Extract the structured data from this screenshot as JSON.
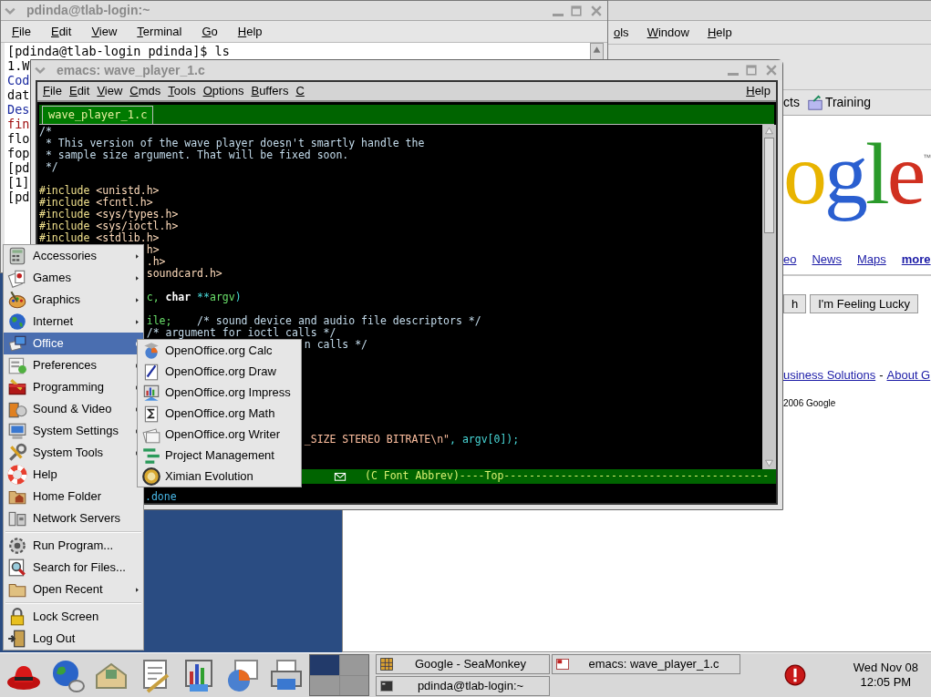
{
  "browser": {
    "menu": [
      "ols",
      "Window",
      "Help"
    ],
    "bookmarks": [
      {
        "text": "cts",
        "kind": "link"
      },
      {
        "text": "Training",
        "kind": "folder"
      }
    ],
    "logo": "ogle",
    "logo_mark": "™",
    "nav_links": [
      {
        "text": "eo",
        "emphasis": false
      },
      {
        "text": "News",
        "emphasis": false
      },
      {
        "text": "Maps",
        "emphasis": false
      },
      {
        "text": "more",
        "emphasis": true
      }
    ],
    "buttons": [
      "h",
      "I'm Feeling Lucky"
    ],
    "footer": [
      {
        "text": "usiness Solutions",
        "kind": "link"
      },
      {
        "text": "-",
        "kind": "text"
      },
      {
        "text": "About G",
        "kind": "link"
      }
    ],
    "copyright": "2006 Google"
  },
  "terminal": {
    "title": "pdinda@tlab-login:~",
    "menu": [
      "File",
      "Edit",
      "View",
      "Terminal",
      "Go",
      "Help"
    ],
    "lines": [
      {
        "text": "[pdinda@tlab-login pdinda]$ ls",
        "kind": "plain"
      },
      {
        "text": "1.W",
        "kind": "plain"
      },
      {
        "text": "Cod",
        "kind": "dir"
      },
      {
        "text": "dat",
        "kind": "plain"
      },
      {
        "text": "Des",
        "kind": "dir"
      },
      {
        "text": "fin",
        "kind": "exec"
      },
      {
        "text": "flo",
        "kind": "plain"
      },
      {
        "text": "fop",
        "kind": "plain"
      },
      {
        "text": "[pd",
        "kind": "plain"
      },
      {
        "text": "[1]",
        "kind": "plain"
      },
      {
        "text": "[pd",
        "kind": "plain"
      }
    ]
  },
  "emacs": {
    "title": "emacs: wave_player_1.c",
    "menu": [
      "File",
      "Edit",
      "View",
      "Cmds",
      "Tools",
      "Options",
      "Buffers",
      "C"
    ],
    "help_menu": "Help",
    "tab": "wave_player_1.c",
    "code": [
      {
        "kind": "code",
        "segments": [
          {
            "kind": "comment",
            "text": "/*"
          }
        ]
      },
      {
        "kind": "code",
        "segments": [
          {
            "kind": "comment",
            "text": " * This version of the wave player doesn't smartly handle the"
          }
        ]
      },
      {
        "kind": "code",
        "segments": [
          {
            "kind": "comment",
            "text": " * sample size argument. That will be fixed soon."
          }
        ]
      },
      {
        "kind": "code",
        "segments": [
          {
            "kind": "comment",
            "text": " */"
          }
        ]
      },
      {
        "kind": "blank"
      },
      {
        "kind": "code",
        "segments": [
          {
            "kind": "preproc",
            "text": "#include "
          },
          {
            "kind": "header",
            "text": "<unistd.h>"
          }
        ]
      },
      {
        "kind": "code",
        "segments": [
          {
            "kind": "preproc",
            "text": "#include "
          },
          {
            "kind": "header",
            "text": "<fcntl.h>"
          }
        ]
      },
      {
        "kind": "code",
        "segments": [
          {
            "kind": "preproc",
            "text": "#include "
          },
          {
            "kind": "header",
            "text": "<sys/types.h>"
          }
        ]
      },
      {
        "kind": "code",
        "segments": [
          {
            "kind": "preproc",
            "text": "#include "
          },
          {
            "kind": "header",
            "text": "<sys/ioctl.h>"
          }
        ]
      },
      {
        "kind": "code",
        "segments": [
          {
            "kind": "preproc",
            "text": "#include "
          },
          {
            "kind": "header",
            "text": "<stdlib.h>"
          }
        ]
      },
      {
        "kind": "code",
        "segments": [
          {
            "kind": "header",
            "text": "                 h>"
          }
        ]
      },
      {
        "kind": "code",
        "segments": [
          {
            "kind": "header",
            "text": "                 .h>"
          }
        ]
      },
      {
        "kind": "code",
        "segments": [
          {
            "kind": "header",
            "text": "                 soundcard.h>"
          }
        ]
      },
      {
        "kind": "blank"
      },
      {
        "kind": "code",
        "segments": [
          {
            "kind": "plain",
            "text": "                 c,"
          },
          {
            "kind": "keyword",
            "text": " char"
          },
          {
            "kind": "op",
            "text": " **"
          },
          {
            "kind": "var",
            "text": "argv"
          },
          {
            "kind": "op",
            "text": ")"
          }
        ]
      },
      {
        "kind": "blank"
      },
      {
        "kind": "code",
        "segments": [
          {
            "kind": "var",
            "text": "                 ile;"
          },
          {
            "kind": "comment",
            "text": "    /* sound device and audio file descriptors */"
          }
        ]
      },
      {
        "kind": "code",
        "segments": [
          {
            "kind": "comment",
            "text": "                 /* argument for ioctl calls */"
          }
        ]
      },
      {
        "kind": "code",
        "segments": [
          {
            "kind": "comment",
            "text": "                                          n calls */"
          }
        ]
      },
      {
        "kind": "blank"
      },
      {
        "kind": "blank"
      },
      {
        "kind": "blank"
      },
      {
        "kind": "blank"
      },
      {
        "kind": "blank"
      },
      {
        "kind": "blank"
      },
      {
        "kind": "blank"
      },
      {
        "kind": "code",
        "segments": [
          {
            "kind": "string",
            "text": "                                          _SIZE STEREO BITRATE\\n\""
          },
          {
            "kind": "op",
            "text": ", argv[0]);"
          }
        ]
      }
    ],
    "modeline": "(C Font Abbrev)----Top------------------------------------------",
    "minibuffer": ".done"
  },
  "app_menu": {
    "items": [
      {
        "kind": "item",
        "label": "Accessories",
        "has_submenu": true,
        "selected": false
      },
      {
        "kind": "item",
        "label": "Games",
        "has_submenu": true,
        "selected": false
      },
      {
        "kind": "item",
        "label": "Graphics",
        "has_submenu": true,
        "selected": false
      },
      {
        "kind": "item",
        "label": "Internet",
        "has_submenu": true,
        "selected": false
      },
      {
        "kind": "item",
        "label": "Office",
        "has_submenu": true,
        "selected": true
      },
      {
        "kind": "item",
        "label": "Preferences",
        "has_submenu": true,
        "selected": false
      },
      {
        "kind": "item",
        "label": "Programming",
        "has_submenu": true,
        "selected": false
      },
      {
        "kind": "item",
        "label": "Sound & Video",
        "has_submenu": true,
        "selected": false
      },
      {
        "kind": "item",
        "label": "System Settings",
        "has_submenu": true,
        "selected": false
      },
      {
        "kind": "item",
        "label": "System Tools",
        "has_submenu": true,
        "selected": false
      },
      {
        "kind": "item",
        "label": "Help",
        "has_submenu": false,
        "selected": false
      },
      {
        "kind": "item",
        "label": "Home Folder",
        "has_submenu": false,
        "selected": false
      },
      {
        "kind": "item",
        "label": "Network Servers",
        "has_submenu": false,
        "selected": false
      },
      {
        "kind": "separator"
      },
      {
        "kind": "item",
        "label": "Run Program...",
        "has_submenu": false,
        "selected": false
      },
      {
        "kind": "item",
        "label": "Search for Files...",
        "has_submenu": false,
        "selected": false
      },
      {
        "kind": "item",
        "label": "Open Recent",
        "has_submenu": true,
        "selected": false
      },
      {
        "kind": "separator"
      },
      {
        "kind": "item",
        "label": "Lock Screen",
        "has_submenu": false,
        "selected": false
      },
      {
        "kind": "item",
        "label": "Log Out",
        "has_submenu": false,
        "selected": false
      }
    ],
    "submenu": [
      "OpenOffice.org Calc",
      "OpenOffice.org Draw",
      "OpenOffice.org Impress",
      "OpenOffice.org Math",
      "OpenOffice.org Writer",
      "Project Management",
      "Ximian Evolution"
    ]
  },
  "panel": {
    "tasks": [
      {
        "title": "Google - SeaMonkey",
        "kind": "browser"
      },
      {
        "title": "emacs: wave_player_1.c",
        "kind": "editor"
      },
      {
        "title": "pdinda@tlab-login:~",
        "kind": "terminal"
      }
    ],
    "clock": {
      "date": "Wed Nov 08",
      "time": "12:05 PM"
    }
  }
}
